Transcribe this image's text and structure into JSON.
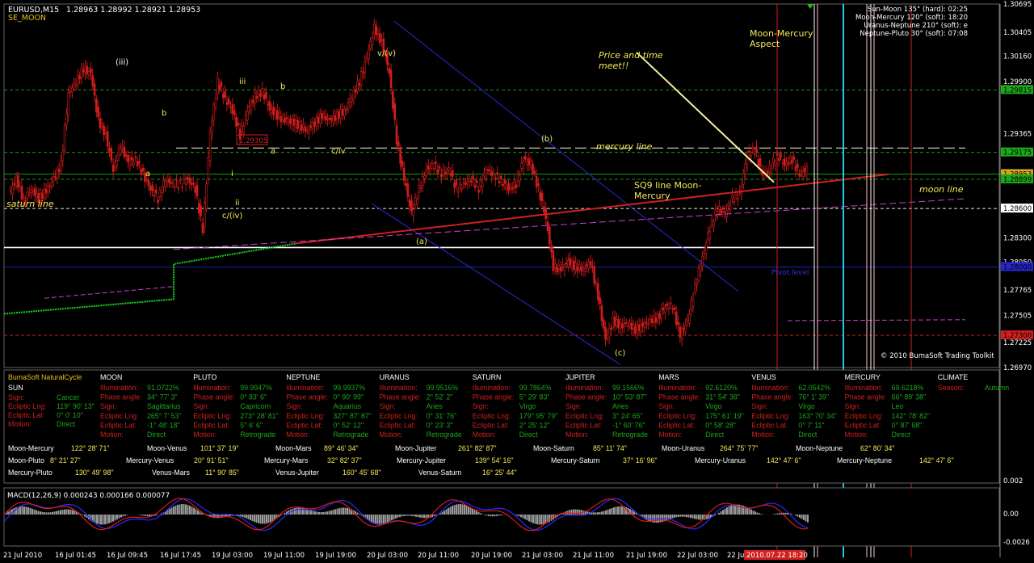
{
  "colors": {
    "bg": "#000000",
    "bull": "#d81b1b",
    "bear": "#b0121b",
    "grid": "#1a1a1a",
    "axis": "#ffffff",
    "green_line": "#1aa81a",
    "blue_line": "#2626cc",
    "red_line": "#d11f1f",
    "magenta": "#cc44cc",
    "yellow": "#f5e85a",
    "cyan": "#27c9e6",
    "pink": "#ffc0c0",
    "white": "#ffffff",
    "lime": "#16d416",
    "buy": "#43a047"
  },
  "header": {
    "symbol": "EURUSD,M15",
    "ohlc": "1.28963 1.28992 1.28921 1.28953",
    "indicator": "SE_MOON"
  },
  "aspects_box": [
    "Sun-Moon 135° (hard): 02:25",
    "Moon-Mercury 120° (soft): 18:20",
    "Uranus-Neptune 210° (soft): e",
    "Neptune-Pluto 30° (soft): 07:08"
  ],
  "annotations": {
    "wave_iii_paren": "(iii)",
    "wave_iii": "iii",
    "wave_b1": "b",
    "wave_b2": "b",
    "wave_a1": "a",
    "wave_a2": "a",
    "wave_i": "i",
    "wave_ii": "ii",
    "wave_civ": "c/iv",
    "wave_c_iv": "c/(iv)",
    "wave_v": "v/(v)",
    "wave_b_paren": "(b)",
    "wave_a_paren": "(a)",
    "wave_c_paren": "(c)",
    "price_box": "1.29305",
    "saturn_line": "saturn line",
    "mercury_line": "mercury line",
    "moon_line": "moon line",
    "sq9": "SQ9 line Moon-",
    "sq9b": "Mercury",
    "price_time": "Price and time",
    "price_time2": "meet!!",
    "moon_mercury_aspect": "Moon-Mercury",
    "moon_mercury_aspect2": "Aspect",
    "pivot": "Pivot level",
    "copyright": "© 2010 BumaSoft Trading Toolkit"
  },
  "price_axis": {
    "labels": [
      "1.30695",
      "1.30405",
      "1.30160",
      "1.29900",
      "1.29365",
      "1.29175",
      "1.28300",
      "1.28050",
      "1.27765",
      "1.27505",
      "1.27225",
      "1.26970"
    ],
    "boxes": [
      {
        "label": "1.29815",
        "color": "#1aa81a"
      },
      {
        "label": "1.29175",
        "color": "#1aa81a"
      },
      {
        "label": "1.28953",
        "color": "#d4a520"
      },
      {
        "label": "1.28899",
        "color": "#1aa81a"
      },
      {
        "label": "1.28600",
        "color": "#ffffff"
      },
      {
        "label": "1.28000",
        "color": "#2626cc"
      },
      {
        "label": "1.27300",
        "color": "#d11f1f"
      }
    ]
  },
  "time_axis": [
    "21 Jul 2010",
    "16 Jul 01:45",
    "16 Jul 09:45",
    "16 Jul 17:45",
    "19 Jul 03:00",
    "19 Jul 11:00",
    "19 Jul 19:00",
    "20 Jul 03:00",
    "20 Jul 11:00",
    "20 Jul 19:00",
    "21 Jul 03:00",
    "21 Jul 11:00",
    "21 Jul 19:00",
    "22 Jul 03:00",
    "22 Jul"
  ],
  "time_marker": "2010.07.22 18:20",
  "natural_cycle": {
    "title": "BumaSoft NaturalCycle",
    "sun": {
      "name": "SUN",
      "rows": [
        [
          "Sign:",
          "Cancer"
        ],
        [
          "Ecliptic Lng:",
          "119° 90' 13\""
        ],
        [
          "Ecliptic Lat:",
          "0° 0' 10\""
        ],
        [
          "Motion:",
          "Direct"
        ]
      ]
    },
    "planets": [
      {
        "name": "MOON",
        "rows": [
          [
            "Illumination:",
            "91.0722%"
          ],
          [
            "Phase angle:",
            "34° 77' 3\""
          ],
          [
            "Sign:",
            "Sagittarius"
          ],
          [
            "Ecliptic Lng:",
            "265° 7' 53\""
          ],
          [
            "Ecliptic Lat:",
            "-1° 48' 18\""
          ],
          [
            "Motion:",
            "Direct"
          ]
        ]
      },
      {
        "name": "PLUTO",
        "rows": [
          [
            "Illumination:",
            "99.9947%"
          ],
          [
            "Phase angle:",
            "0° 83' 6\""
          ],
          [
            "Sign:",
            "Capricorn"
          ],
          [
            "Ecliptic Lng:",
            "273° 28' 81\""
          ],
          [
            "Ecliptic Lat:",
            "5° 6' 6\""
          ],
          [
            "Motion:",
            "Retrograde"
          ]
        ]
      },
      {
        "name": "NEPTUNE",
        "rows": [
          [
            "Illumination:",
            "99.9937%"
          ],
          [
            "Phase angle:",
            "0° 90' 99\""
          ],
          [
            "Sign:",
            "Aquarius"
          ],
          [
            "Ecliptic Lng:",
            "327° 87' 87\""
          ],
          [
            "Ecliptic Lat:",
            "0° 52' 12\""
          ],
          [
            "Motion:",
            "Retrograde"
          ]
        ]
      },
      {
        "name": "URANUS",
        "rows": [
          [
            "Illumination:",
            "99.9516%"
          ],
          [
            "Phase angle:",
            "2° 52' 2\""
          ],
          [
            "Sign:",
            "Aries"
          ],
          [
            "Ecliptic Lng:",
            "0° 31' 76\""
          ],
          [
            "Ecliptic Lat:",
            "0° 23' 3\""
          ],
          [
            "Motion:",
            "Retrograde"
          ]
        ]
      },
      {
        "name": "SATURN",
        "rows": [
          [
            "Illumination:",
            "99.7864%"
          ],
          [
            "Phase angle:",
            "5° 29' 83\""
          ],
          [
            "Sign:",
            "Virgo"
          ],
          [
            "Ecliptic Lng:",
            "179° 95' 79\""
          ],
          [
            "Ecliptic Lat:",
            "2° 25' 12\""
          ],
          [
            "Motion:",
            "Direct"
          ]
        ]
      },
      {
        "name": "JUPITER",
        "rows": [
          [
            "Illumination:",
            "99.1566%"
          ],
          [
            "Phase angle:",
            "10° 53' 87\""
          ],
          [
            "Sign:",
            "Aries"
          ],
          [
            "Ecliptic Lng:",
            "3° 24' 65\""
          ],
          [
            "Ecliptic Lat:",
            "-1° 60' 76\""
          ],
          [
            "Motion:",
            "Retrograde"
          ]
        ]
      },
      {
        "name": "MARS",
        "rows": [
          [
            "Illumination:",
            "92.6120%"
          ],
          [
            "Phase angle:",
            "31° 54' 38\""
          ],
          [
            "Sign:",
            "Virgo"
          ],
          [
            "Ecliptic Lng:",
            "175° 61' 19\""
          ],
          [
            "Ecliptic Lat:",
            "0° 58' 28\""
          ],
          [
            "Motion:",
            "Direct"
          ]
        ]
      },
      {
        "name": "VENUS",
        "rows": [
          [
            "Illumination:",
            "62.0542%"
          ],
          [
            "Phase angle:",
            "76° 1' 39\""
          ],
          [
            "Sign:",
            "Virgo"
          ],
          [
            "Ecliptic Lng:",
            "163° 70' 34\""
          ],
          [
            "Ecliptic Lat:",
            "0° 7' 11\""
          ],
          [
            "Motion:",
            "Direct"
          ]
        ]
      },
      {
        "name": "MERCURY",
        "rows": [
          [
            "Illumination:",
            "69.6218%"
          ],
          [
            "Phase angle:",
            "66° 89' 38\""
          ],
          [
            "Sign:",
            "Leo"
          ],
          [
            "Ecliptic Lng:",
            "142° 78' 82\""
          ],
          [
            "Ecliptic Lat:",
            "0° 87' 68\""
          ],
          [
            "Motion:",
            "Direct"
          ]
        ]
      },
      {
        "name": "CLIMATE",
        "rows": [
          [
            "Season:",
            "Autumn"
          ]
        ]
      }
    ],
    "pairs": [
      [
        [
          "Moon-Mercury",
          "122° 28' 71\""
        ],
        [
          "Moon-Venus",
          "101° 37' 19\""
        ],
        [
          "Moon-Mars",
          "89° 46' 34\""
        ],
        [
          "Moon-Jupiter",
          "261° 82' 87\""
        ],
        [
          "Moon-Saturn",
          "85° 11' 74\""
        ],
        [
          "Moon-Uranus",
          "264° 75' 77\""
        ],
        [
          "Moon-Neptune",
          "62° 80' 34\""
        ]
      ],
      [
        [
          "Moon-Pluto",
          "8° 21' 27\""
        ],
        [
          "Mercury-Venus",
          "20° 91' 51\""
        ],
        [
          "Mercury-Mars",
          "32° 82' 37\""
        ],
        [
          "Mercury-Jupiter",
          "139° 54' 16\""
        ],
        [
          "Mercury-Saturn",
          "37° 16' 96\""
        ],
        [
          "Mercury-Uranus",
          "142° 47' 6\""
        ],
        [
          "Mercury-Neptune",
          "142° 47' 6\""
        ]
      ],
      [
        [
          "Mercury-Pluto",
          "130° 49' 98\""
        ],
        [
          "Venus-Mars",
          "11° 90' 85\""
        ],
        [
          "Venus-Jupiter",
          "160° 45' 68\""
        ],
        [
          "Venus-Saturn",
          "16° 25' 44\""
        ]
      ]
    ]
  },
  "macd": {
    "label": "MACD(12,26,9) 0.000243 0.000166 0.000077",
    "axis": [
      "0.002",
      "0.00",
      "-0.0026"
    ]
  },
  "chart_data": {
    "type": "candlestick",
    "symbol": "EURUSD",
    "timeframe": "M15",
    "ylim": [
      1.2697,
      1.30695
    ],
    "y_ticks": [
      1.30695,
      1.30405,
      1.3016,
      1.299,
      1.29365,
      1.29175,
      1.283,
      1.2805,
      1.27765,
      1.27505,
      1.27225,
      1.2697
    ],
    "close_path": [
      1.2875,
      1.289,
      1.2868,
      1.288,
      1.287,
      1.2878,
      1.289,
      1.2905,
      1.2978,
      1.299,
      1.3003,
      1.2998,
      1.295,
      1.2935,
      1.29,
      1.2925,
      1.2908,
      1.291,
      1.2895,
      1.288,
      1.287,
      1.289,
      1.2885,
      1.2885,
      1.289,
      1.288,
      1.2838,
      1.2937,
      1.299,
      1.2972,
      1.296,
      1.2935,
      1.296,
      1.2975,
      1.298,
      1.2962,
      1.2955,
      1.295,
      1.2948,
      1.2945,
      1.294,
      1.2948,
      1.2955,
      1.295,
      1.2955,
      1.296,
      1.2975,
      1.299,
      1.3015,
      1.3045,
      1.303,
      1.3,
      1.293,
      1.289,
      1.2855,
      1.288,
      1.29,
      1.2905,
      1.2895,
      1.29,
      1.288,
      1.2885,
      1.289,
      1.288,
      1.29,
      1.2895,
      1.2888,
      1.288,
      1.2885,
      1.291,
      1.2905,
      1.288,
      1.285,
      1.28,
      1.2798,
      1.2805,
      1.28,
      1.2798,
      1.2805,
      1.277,
      1.2725,
      1.2745,
      1.274,
      1.2742,
      1.2736,
      1.274,
      1.2745,
      1.2748,
      1.276,
      1.276,
      1.273,
      1.2745,
      1.278,
      1.281,
      1.284,
      1.286,
      1.2855,
      1.287,
      1.2875,
      1.2915,
      1.292,
      1.2895,
      1.29,
      1.2915,
      1.2905,
      1.291,
      1.2895,
      1.29
    ],
    "labels": [
      "(iii)",
      "iii",
      "b",
      "b",
      "a",
      "a",
      "i",
      "ii",
      "c/iv",
      "c/(iv)",
      "v/(v)",
      "(b)",
      "(a)",
      "(c)"
    ],
    "horizontal_levels": [
      {
        "name": "1.29815",
        "value": 1.29815,
        "style": "dashed",
        "color": "#1aa81a"
      },
      {
        "name": "1.29175",
        "value": 1.29175,
        "style": "dashed",
        "color": "#1aa81a"
      },
      {
        "name": "1.28953",
        "value": 1.28953,
        "style": "solid",
        "color": "#1aa81a"
      },
      {
        "name": "1.28899",
        "value": 1.28899,
        "style": "dashed",
        "color": "#1aa81a"
      },
      {
        "name": "1.28600",
        "value": 1.286,
        "style": "dashed",
        "color": "#ffffff"
      },
      {
        "name": "1.28000",
        "value": 1.28,
        "style": "solid",
        "color": "#2626cc"
      },
      {
        "name": "1.27300",
        "value": 1.273,
        "style": "dashed",
        "color": "#d11f1f"
      }
    ]
  }
}
